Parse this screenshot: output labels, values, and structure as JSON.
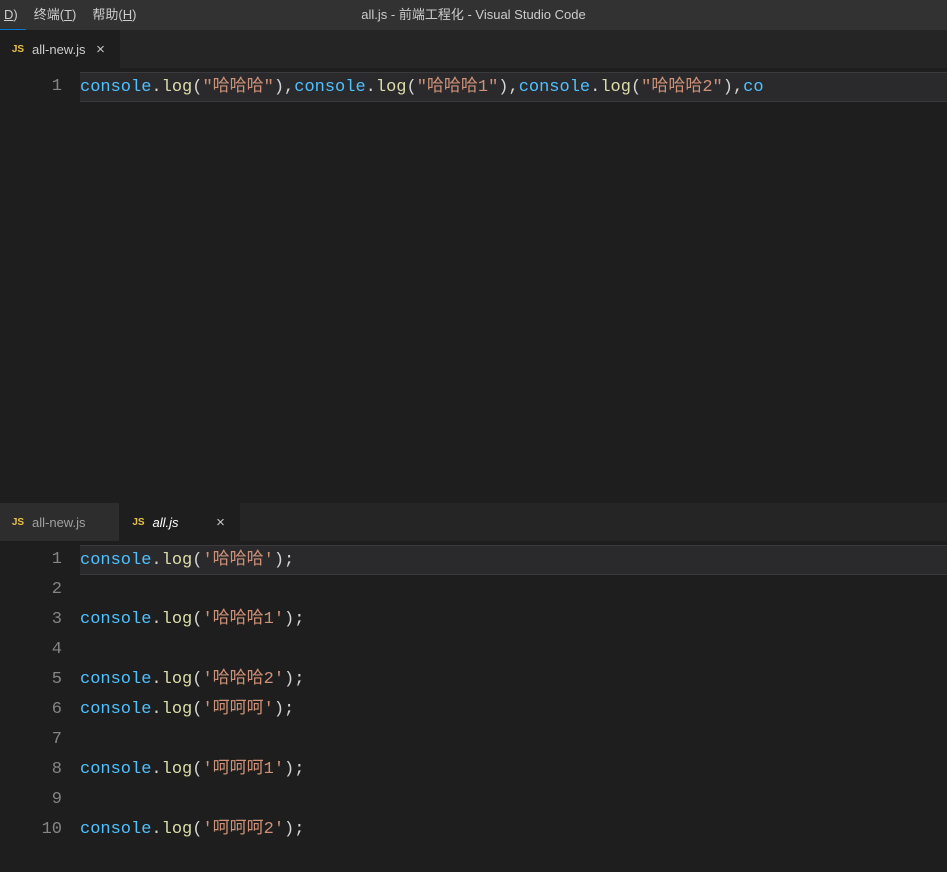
{
  "menubar": {
    "items": [
      {
        "label_pre": "",
        "mnemonic": "D",
        "label_post": ")"
      },
      {
        "label_pre": "终端(",
        "mnemonic": "T",
        "label_post": ")"
      },
      {
        "label_pre": "帮助(",
        "mnemonic": "H",
        "label_post": ")"
      }
    ]
  },
  "window_title": "all.js - 前端工程化 - Visual Studio Code",
  "icons": {
    "js": "JS",
    "close": "×"
  },
  "group_top": {
    "tabs": [
      {
        "icon": "js",
        "label": "all-new.js",
        "active": true
      }
    ],
    "lines": [
      {
        "n": "1",
        "tokens": [
          {
            "c": "tok-obj",
            "t": "console"
          },
          {
            "c": "tok-punc",
            "t": "."
          },
          {
            "c": "tok-fn",
            "t": "log"
          },
          {
            "c": "tok-punc",
            "t": "("
          },
          {
            "c": "tok-str",
            "t": "\"哈哈哈\""
          },
          {
            "c": "tok-punc",
            "t": "),"
          },
          {
            "c": "tok-obj",
            "t": "console"
          },
          {
            "c": "tok-punc",
            "t": "."
          },
          {
            "c": "tok-fn",
            "t": "log"
          },
          {
            "c": "tok-punc",
            "t": "("
          },
          {
            "c": "tok-str",
            "t": "\"哈哈哈1\""
          },
          {
            "c": "tok-punc",
            "t": "),"
          },
          {
            "c": "tok-obj",
            "t": "console"
          },
          {
            "c": "tok-punc",
            "t": "."
          },
          {
            "c": "tok-fn",
            "t": "log"
          },
          {
            "c": "tok-punc",
            "t": "("
          },
          {
            "c": "tok-str",
            "t": "\"哈哈哈2\""
          },
          {
            "c": "tok-punc",
            "t": "),"
          },
          {
            "c": "tok-obj",
            "t": "co"
          }
        ],
        "current": true
      }
    ]
  },
  "group_bottom": {
    "tabs": [
      {
        "icon": "js",
        "label": "all-new.js",
        "active": false
      },
      {
        "icon": "js",
        "label": "all.js",
        "active": true,
        "italic": true
      }
    ],
    "lines": [
      {
        "n": "1",
        "tokens": [
          {
            "c": "tok-obj",
            "t": "console"
          },
          {
            "c": "tok-punc",
            "t": "."
          },
          {
            "c": "tok-fn",
            "t": "log"
          },
          {
            "c": "tok-punc",
            "t": "("
          },
          {
            "c": "tok-str",
            "t": "'哈哈哈'"
          },
          {
            "c": "tok-punc",
            "t": ");"
          }
        ],
        "current": true
      },
      {
        "n": "2",
        "tokens": []
      },
      {
        "n": "3",
        "tokens": [
          {
            "c": "tok-obj",
            "t": "console"
          },
          {
            "c": "tok-punc",
            "t": "."
          },
          {
            "c": "tok-fn",
            "t": "log"
          },
          {
            "c": "tok-punc",
            "t": "("
          },
          {
            "c": "tok-str",
            "t": "'哈哈哈1'"
          },
          {
            "c": "tok-punc",
            "t": ");"
          }
        ]
      },
      {
        "n": "4",
        "tokens": []
      },
      {
        "n": "5",
        "tokens": [
          {
            "c": "tok-obj",
            "t": "console"
          },
          {
            "c": "tok-punc",
            "t": "."
          },
          {
            "c": "tok-fn",
            "t": "log"
          },
          {
            "c": "tok-punc",
            "t": "("
          },
          {
            "c": "tok-str",
            "t": "'哈哈哈2'"
          },
          {
            "c": "tok-punc",
            "t": ");"
          }
        ]
      },
      {
        "n": "6",
        "tokens": [
          {
            "c": "tok-obj",
            "t": "console"
          },
          {
            "c": "tok-punc",
            "t": "."
          },
          {
            "c": "tok-fn",
            "t": "log"
          },
          {
            "c": "tok-punc",
            "t": "("
          },
          {
            "c": "tok-str",
            "t": "'呵呵呵'"
          },
          {
            "c": "tok-punc",
            "t": ");"
          }
        ]
      },
      {
        "n": "7",
        "tokens": []
      },
      {
        "n": "8",
        "tokens": [
          {
            "c": "tok-obj",
            "t": "console"
          },
          {
            "c": "tok-punc",
            "t": "."
          },
          {
            "c": "tok-fn",
            "t": "log"
          },
          {
            "c": "tok-punc",
            "t": "("
          },
          {
            "c": "tok-str",
            "t": "'呵呵呵1'"
          },
          {
            "c": "tok-punc",
            "t": ");"
          }
        ]
      },
      {
        "n": "9",
        "tokens": []
      },
      {
        "n": "10",
        "tokens": [
          {
            "c": "tok-obj",
            "t": "console"
          },
          {
            "c": "tok-punc",
            "t": "."
          },
          {
            "c": "tok-fn",
            "t": "log"
          },
          {
            "c": "tok-punc",
            "t": "("
          },
          {
            "c": "tok-str",
            "t": "'呵呵呵2'"
          },
          {
            "c": "tok-punc",
            "t": ");"
          }
        ]
      }
    ]
  }
}
